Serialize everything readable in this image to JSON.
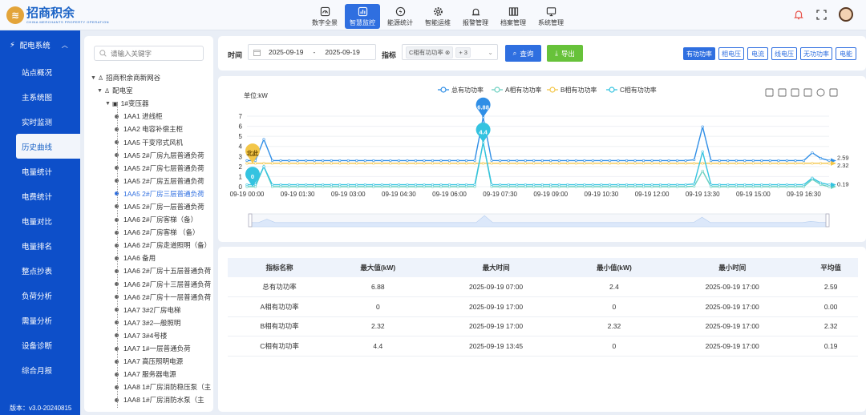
{
  "app": {
    "logo_text": "招商积余",
    "logo_sub": "CHINA MERCHANTS PROPERTY OPERATION",
    "version": "版本：v3.0-20240815"
  },
  "topnav": [
    {
      "label": "数字全景",
      "icon": "speedometer-icon"
    },
    {
      "label": "智慧监控",
      "icon": "bar-chart-icon",
      "active": true
    },
    {
      "label": "能源统计",
      "icon": "lightning-icon"
    },
    {
      "label": "智能运维",
      "icon": "gear-icon"
    },
    {
      "label": "报警管理",
      "icon": "alarm-icon"
    },
    {
      "label": "档案管理",
      "icon": "archive-icon"
    },
    {
      "label": "系统管理",
      "icon": "monitor-icon"
    }
  ],
  "sidebar": {
    "group_label": "配电系统",
    "items": [
      {
        "label": "站点概况"
      },
      {
        "label": "主系统图"
      },
      {
        "label": "实时监测"
      },
      {
        "label": "历史曲线",
        "active": true
      },
      {
        "label": "电量统计"
      },
      {
        "label": "电费统计"
      },
      {
        "label": "电量对比"
      },
      {
        "label": "电量排名"
      },
      {
        "label": "整点抄表"
      },
      {
        "label": "负荷分析"
      },
      {
        "label": "需量分析"
      },
      {
        "label": "设备诊断"
      },
      {
        "label": "综合月报"
      }
    ]
  },
  "tree": {
    "search_placeholder": "请输入关键字",
    "nodes": [
      {
        "label": "招商积余商新网谷",
        "level": 0,
        "kind": "building"
      },
      {
        "label": "配电室",
        "level": 1,
        "kind": "building"
      },
      {
        "label": "1#变压器",
        "level": 2,
        "kind": "transformer"
      },
      {
        "label": "1AA1 进线柜",
        "level": 3
      },
      {
        "label": "1AA2 电容补偿主柜",
        "level": 3
      },
      {
        "label": "1AA5 干变帘式风机",
        "level": 3
      },
      {
        "label": "1AA5 2#厂房九层普通负荷",
        "level": 3
      },
      {
        "label": "1AA5 2#厂房七层普通负荷",
        "level": 3
      },
      {
        "label": "1AA5 2#厂房五层普通负荷",
        "level": 3
      },
      {
        "label": "1AA5 2#厂房三层普通负荷",
        "level": 3,
        "selected": true
      },
      {
        "label": "1AA5 2#厂房一层普通负荷",
        "level": 3
      },
      {
        "label": "1AA6 2#厂房客梯（备）",
        "level": 3
      },
      {
        "label": "1AA6 2#厂房客梯 （备）",
        "level": 3
      },
      {
        "label": "1AA6 2#厂房走道照明（备）",
        "level": 3
      },
      {
        "label": "1AA6 备用",
        "level": 3
      },
      {
        "label": "1AA6 2#厂房十五层普通负荷",
        "level": 3
      },
      {
        "label": "1AA6 2#厂房十三层普通负荷",
        "level": 3
      },
      {
        "label": "1AA6 2#厂房十一层普通负荷",
        "level": 3
      },
      {
        "label": "1AA7 3#2厂房电梯",
        "level": 3
      },
      {
        "label": "1AA7 3#2—般照明",
        "level": 3
      },
      {
        "label": "1AA7 3#4号楼",
        "level": 3
      },
      {
        "label": "1AA7 1#一层普通负荷",
        "level": 3
      },
      {
        "label": "1AA7 高压照明电源",
        "level": 3
      },
      {
        "label": "1AA7 服务器电源",
        "level": 3
      },
      {
        "label": "1AA8 1#厂房消防稳压泵（主",
        "level": 3
      },
      {
        "label": "1AA8 1#厂房消防水泵（主",
        "level": 3
      }
    ]
  },
  "query": {
    "time_label": "时间",
    "date_start": "2025-09-19",
    "date_sep": "-",
    "date_end": "2025-09-19",
    "metric_label": "指标",
    "metric_tag": "C相有功功率",
    "metric_more": "+ 3",
    "search_btn": "查询",
    "export_btn": "导出",
    "tabs": [
      {
        "label": "有功功率",
        "active": true
      },
      {
        "label": "相电压"
      },
      {
        "label": "电流"
      },
      {
        "label": "线电压"
      },
      {
        "label": "无功功率"
      },
      {
        "label": "电能"
      }
    ]
  },
  "colors": {
    "primary": "#2f6fe0",
    "sidebar": "#0d4fc9",
    "export": "#67c23a",
    "total": "#2f8ee6",
    "phase_a": "#6ad0c0",
    "phase_b": "#f3c648",
    "phase_c": "#34c3e0"
  },
  "chart_data": {
    "type": "line",
    "ylabel": "单位:kW",
    "ylim": [
      0,
      7
    ],
    "yticks": [
      0,
      1,
      2,
      3,
      4,
      5,
      6,
      7
    ],
    "xlabels": [
      "09-19 00:00",
      "09-19 01:30",
      "09-19 03:00",
      "09-19 04:30",
      "09-19 06:00",
      "09-19 07:30",
      "09-19 09:00",
      "09-19 10:30",
      "09-19 12:00",
      "09-19 13:30",
      "09-19 15:00",
      "09-19 16:30"
    ],
    "x_range_hours": [
      0,
      17.25
    ],
    "legend_position": "top",
    "series": [
      {
        "name": "总有功功率",
        "color": "#2f8ee6",
        "base": 2.59,
        "peaks": [
          [
            0.5,
            4.7
          ],
          [
            7.0,
            6.88
          ],
          [
            13.45,
            6.9
          ],
          [
            16.85,
            4.7
          ]
        ]
      },
      {
        "name": "A相有功功率",
        "color": "#6ad0c0",
        "base": 0,
        "peaks": [
          [
            0.5,
            2.0
          ],
          [
            7.0,
            4.4
          ],
          [
            13.45,
            2.0
          ],
          [
            16.85,
            2.0
          ]
        ]
      },
      {
        "name": "B相有功功率",
        "color": "#f3c648",
        "base": 2.32,
        "peaks": []
      },
      {
        "name": "C相有功功率",
        "color": "#34c3e0",
        "base": 0.19,
        "peaks": [
          [
            0.5,
            2.0
          ],
          [
            7.0,
            4.4
          ],
          [
            13.45,
            4.4
          ],
          [
            16.85,
            2.0
          ]
        ]
      }
    ],
    "markers": [
      {
        "label": "6.88",
        "x": 7.0,
        "y": 6.88,
        "color": "#2f8ee6"
      },
      {
        "label": "4.4",
        "x": 7.0,
        "y": 4.4,
        "color": "#34c3e0"
      },
      {
        "label": "北此",
        "x": 0.0,
        "y": 2.32,
        "color": "#f3c648"
      },
      {
        "label": "0",
        "x": 0.0,
        "y": 0,
        "color": "#34c3e0"
      }
    ],
    "end_labels": [
      "2.59",
      "2.32",
      "0.19"
    ]
  },
  "stats_table": {
    "headers": [
      "指标名称",
      "最大值(kW)",
      "最大时间",
      "最小值(kW)",
      "最小时间",
      "平均值"
    ],
    "rows": [
      [
        "总有功功率",
        "6.88",
        "2025-09-19 07:00",
        "2.4",
        "2025-09-19 17:00",
        "2.59"
      ],
      [
        "A相有功功率",
        "0",
        "2025-09-19 17:00",
        "0",
        "2025-09-19 17:00",
        "0.00"
      ],
      [
        "B相有功功率",
        "2.32",
        "2025-09-19 17:00",
        "2.32",
        "2025-09-19 17:00",
        "2.32"
      ],
      [
        "C相有功功率",
        "4.4",
        "2025-09-19 13:45",
        "0",
        "2025-09-19 17:00",
        "0.19"
      ]
    ]
  }
}
